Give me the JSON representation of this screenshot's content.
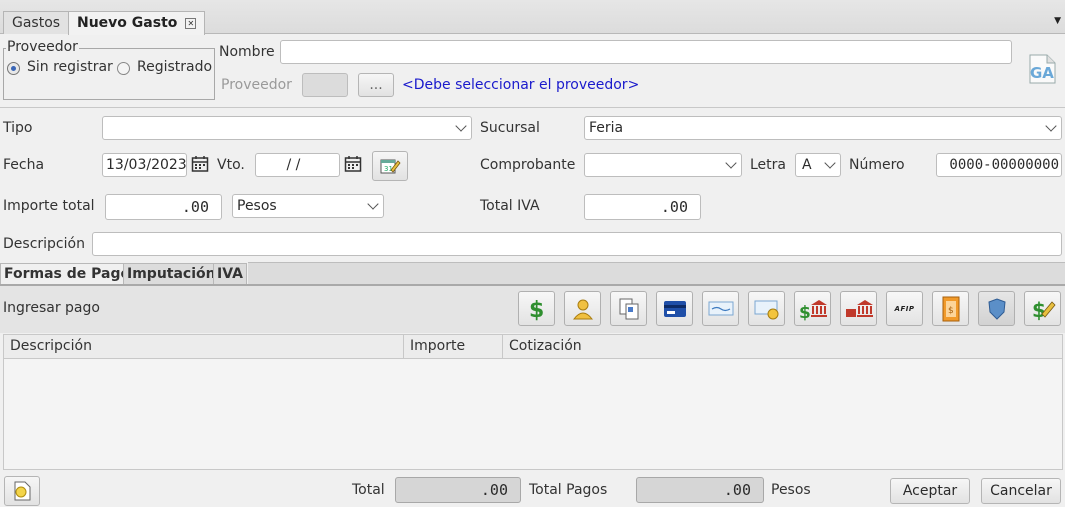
{
  "tabs": [
    {
      "label": "Gastos"
    },
    {
      "label": "Nuevo Gasto"
    }
  ],
  "proveedor_group": {
    "legend": "Proveedor",
    "options": [
      {
        "label": "Sin registrar",
        "selected": true
      },
      {
        "label": "Registrado",
        "selected": false
      }
    ]
  },
  "nombre": {
    "label": "Nombre",
    "value": ""
  },
  "proveedor": {
    "label": "Proveedor",
    "value": "",
    "browse_label": "...",
    "hint": "<Debe seleccionar el proveedor>"
  },
  "logo_text": "GA",
  "tipo": {
    "label": "Tipo",
    "value": ""
  },
  "sucursal": {
    "label": "Sucursal",
    "value": "Feria"
  },
  "fecha": {
    "label": "Fecha",
    "value": "13/03/2023"
  },
  "vto": {
    "label": "Vto.",
    "value": " / /"
  },
  "comprobante": {
    "label": "Comprobante",
    "value": ""
  },
  "letra": {
    "label": "Letra",
    "value": "A"
  },
  "numero": {
    "label": "Número",
    "value": "0000-00000000"
  },
  "importe_total": {
    "label": "Importe total",
    "value": ".00",
    "moneda": "Pesos"
  },
  "total_iva": {
    "label": "Total IVA",
    "value": ".00"
  },
  "descripcion": {
    "label": "Descripción",
    "value": ""
  },
  "inner_tabs": [
    {
      "label": "Formas de Pago"
    },
    {
      "label": "Imputación"
    },
    {
      "label": "IVA"
    }
  ],
  "ingresar_pago": "Ingresar pago",
  "payment_icons": [
    "dollar-icon",
    "person-icon",
    "documents-icon",
    "card-icon",
    "check-icon",
    "cheque-icon",
    "bank-dollar-icon",
    "bank-transfer-icon",
    "afip-icon",
    "voucher-icon",
    "shield-icon",
    "edit-dollar-icon"
  ],
  "afip_text": "AFIP",
  "table": {
    "columns": [
      "Descripción",
      "Importe",
      "Cotización"
    ],
    "rows": []
  },
  "footer": {
    "total_label": "Total",
    "total_value": ".00",
    "total_pagos_label": "Total Pagos",
    "total_pagos_value": ".00",
    "moneda": "Pesos",
    "aceptar": "Aceptar",
    "cancelar": "Cancelar"
  },
  "colors": {
    "link": "#1a1acc",
    "window_bg": "#f0f0f0"
  }
}
